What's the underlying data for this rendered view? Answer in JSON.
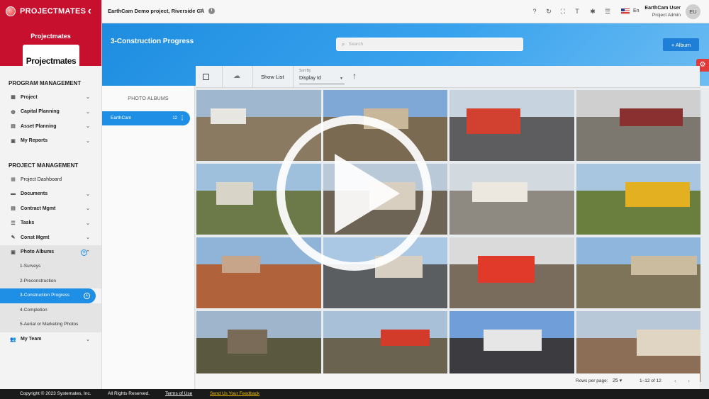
{
  "brand": {
    "name": "PROJECTMATES",
    "subtitle": "Projectmates",
    "logo_text": "Projectmates"
  },
  "sidebar": {
    "program_section": "PROGRAM MANAGEMENT",
    "program_items": [
      {
        "label": "Project",
        "icon": "building-icon"
      },
      {
        "label": "Capital Planning",
        "icon": "globe-icon"
      },
      {
        "label": "Asset Planning",
        "icon": "chart-icon"
      },
      {
        "label": "My Reports",
        "icon": "report-icon"
      }
    ],
    "project_section": "PROJECT MANAGEMENT",
    "project_items": [
      {
        "label": "Project Dashboard",
        "icon": "dashboard-icon"
      },
      {
        "label": "Documents",
        "icon": "folder-icon"
      },
      {
        "label": "Contract Mgmt",
        "icon": "contract-icon"
      },
      {
        "label": "Tasks",
        "icon": "tasks-icon"
      },
      {
        "label": "Const Mgmt",
        "icon": "wrench-icon"
      },
      {
        "label": "Photo Albums",
        "icon": "photo-icon"
      }
    ],
    "album_subitems": [
      "1-Surveys",
      "2-Preconstruction",
      "3-Construction Progress",
      "4-Completion",
      "5-Aerial or Marketing Photos"
    ],
    "team": {
      "label": "My Team",
      "icon": "team-icon"
    }
  },
  "topbar": {
    "project_name": "EarthCam Demo project, Riverside CA",
    "language": "En",
    "user_name": "EarthCam User",
    "user_role": "Project Admin",
    "avatar_initials": "EU"
  },
  "banner": {
    "title": "3-Construction Progress",
    "search_placeholder": "Search",
    "album_button": "+ Album"
  },
  "album_panel": {
    "heading": "PHOTO ALBUMS",
    "albums": [
      {
        "name": "EarthCam",
        "count": "12"
      }
    ]
  },
  "toolbar": {
    "show_list": "Show List",
    "sort_by_label": "Sort By",
    "sort_by_value": "Display Id"
  },
  "photos": [
    {
      "sky": "#9fb7cf",
      "ground": "#8a7a62",
      "bld": "#e8e6e0"
    },
    {
      "sky": "#7fa8d6",
      "ground": "#7a6a52",
      "bld": "#c9b79a"
    },
    {
      "sky": "#c7d3de",
      "ground": "#5d5d60",
      "bld": "#d24030"
    },
    {
      "sky": "#cfcfcf",
      "ground": "#7c7870",
      "bld": "#8a3030"
    },
    {
      "sky": "#9fc0dd",
      "ground": "#6c7a4a",
      "bld": "#d8d4c8"
    },
    {
      "sky": "#b9c9d8",
      "ground": "#6e6456",
      "bld": "#d8cfc0"
    },
    {
      "sky": "#d2d9df",
      "ground": "#8e8a82",
      "bld": "#ece8e0"
    },
    {
      "sky": "#a8c6e0",
      "ground": "#6a7f3e",
      "bld": "#e2b020"
    },
    {
      "sky": "#90b4d8",
      "ground": "#b0623a",
      "bld": "#c7a58a"
    },
    {
      "sky": "#aac7e3",
      "ground": "#5a5e60",
      "bld": "#d7d0c2"
    },
    {
      "sky": "#dadada",
      "ground": "#7a6c5c",
      "bld": "#e23a2a"
    },
    {
      "sky": "#8fb6dc",
      "ground": "#7d745a",
      "bld": "#cbbca0"
    },
    {
      "sky": "#9eb5cc",
      "ground": "#5b5840",
      "bld": "#7a6a58"
    },
    {
      "sky": "#a9c1d8",
      "ground": "#6a6350",
      "bld": "#d23a2a"
    },
    {
      "sky": "#6f9ed8",
      "ground": "#3c3c40",
      "bld": "#e6e6e6"
    },
    {
      "sky": "#b8c8d8",
      "ground": "#8b6e55",
      "bld": "#e0d5c2"
    }
  ],
  "pager": {
    "rows_label": "Rows per page:",
    "rows_value": "25 ▾",
    "range": "1–12 of 12"
  },
  "footer": {
    "copyright": "Copyright © 2023 Systemates, Inc.",
    "rights": "All Rights Reserved.",
    "terms": "Terms of Use",
    "feedback": "Send Us Your Feedback"
  },
  "colors": {
    "brand_red": "#c7102e",
    "accent_blue": "#1f8fe5",
    "settings_red": "#e03a3a"
  }
}
